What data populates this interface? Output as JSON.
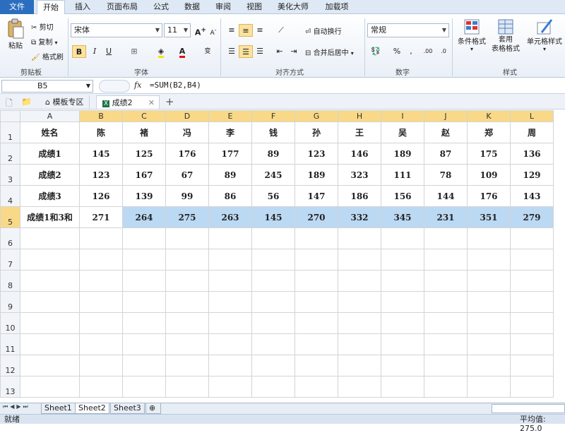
{
  "menu": {
    "file": "文件",
    "tabs": [
      "开始",
      "插入",
      "页面布局",
      "公式",
      "数据",
      "审阅",
      "视图",
      "美化大师",
      "加载项"
    ],
    "active_tab": "开始"
  },
  "ribbon": {
    "clipboard": {
      "label": "剪贴板",
      "paste": "粘贴",
      "cut": "剪切",
      "copy": "复制",
      "format_painter": "格式刷"
    },
    "font": {
      "label": "字体",
      "name": "宋体",
      "size": "11",
      "bold": "B",
      "italic": "I",
      "underline": "U"
    },
    "alignment": {
      "label": "对齐方式",
      "wrap": "自动换行",
      "merge": "合并后居中"
    },
    "number": {
      "label": "数字",
      "format": "常规",
      "percent": "%",
      "comma": ","
    },
    "styles": {
      "label": "样式",
      "conditional": "条件格式",
      "table_format": "套用\n表格格式",
      "cell_style": "单元格样式"
    }
  },
  "formula_bar": {
    "name_box": "B5",
    "fx": "fx",
    "formula": "=SUM(B2,B4)"
  },
  "doc_tabs": [
    "模板专区",
    "成绩2"
  ],
  "columns": [
    "A",
    "B",
    "C",
    "D",
    "E",
    "F",
    "G",
    "H",
    "I",
    "J",
    "K",
    "L"
  ],
  "rows": [
    {
      "num": "1",
      "cells": [
        "姓名",
        "陈",
        "褚",
        "冯",
        "李",
        "钱",
        "孙",
        "王",
        "吴",
        "赵",
        "郑",
        "周"
      ]
    },
    {
      "num": "2",
      "cells": [
        "成绩1",
        "145",
        "125",
        "176",
        "177",
        "89",
        "123",
        "146",
        "189",
        "87",
        "175",
        "136"
      ]
    },
    {
      "num": "3",
      "cells": [
        "成绩2",
        "123",
        "167",
        "67",
        "89",
        "245",
        "189",
        "323",
        "111",
        "78",
        "109",
        "129"
      ]
    },
    {
      "num": "4",
      "cells": [
        "成绩3",
        "126",
        "139",
        "99",
        "86",
        "56",
        "147",
        "186",
        "156",
        "144",
        "176",
        "143"
      ]
    },
    {
      "num": "5",
      "cells": [
        "成绩1和3和",
        "271",
        "264",
        "275",
        "263",
        "145",
        "270",
        "332",
        "345",
        "231",
        "351",
        "279"
      ]
    },
    {
      "num": "6",
      "cells": [
        "",
        "",
        "",
        "",
        "",
        "",
        "",
        "",
        "",
        "",
        "",
        ""
      ]
    },
    {
      "num": "7",
      "cells": [
        "",
        "",
        "",
        "",
        "",
        "",
        "",
        "",
        "",
        "",
        "",
        ""
      ]
    },
    {
      "num": "8",
      "cells": [
        "",
        "",
        "",
        "",
        "",
        "",
        "",
        "",
        "",
        "",
        "",
        ""
      ]
    },
    {
      "num": "9",
      "cells": [
        "",
        "",
        "",
        "",
        "",
        "",
        "",
        "",
        "",
        "",
        "",
        ""
      ]
    },
    {
      "num": "10",
      "cells": [
        "",
        "",
        "",
        "",
        "",
        "",
        "",
        "",
        "",
        "",
        "",
        ""
      ]
    },
    {
      "num": "11",
      "cells": [
        "",
        "",
        "",
        "",
        "",
        "",
        "",
        "",
        "",
        "",
        "",
        ""
      ]
    },
    {
      "num": "12",
      "cells": [
        "",
        "",
        "",
        "",
        "",
        "",
        "",
        "",
        "",
        "",
        "",
        ""
      ]
    },
    {
      "num": "13",
      "cells": [
        "",
        "",
        "",
        "",
        "",
        "",
        "",
        "",
        "",
        "",
        "",
        ""
      ]
    }
  ],
  "sheets": [
    "Sheet1",
    "Sheet2",
    "Sheet3"
  ],
  "active_sheet": "Sheet2",
  "status": {
    "ready": "就绪",
    "average": "平均值: 275.0"
  },
  "colors": {
    "selected_range": "#bcd9f3",
    "header_highlight": "#f9d987",
    "file_tab": "#2b6ebf"
  }
}
